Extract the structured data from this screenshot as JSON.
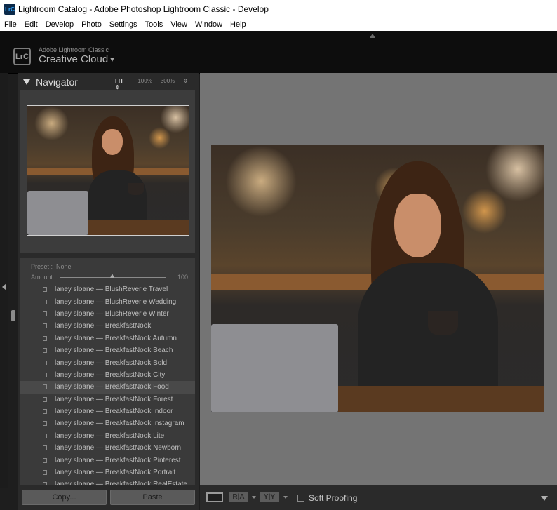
{
  "window": {
    "title": "Lightroom Catalog - Adobe Photoshop Lightroom Classic - Develop",
    "app_icon_text": "LrC"
  },
  "menu": [
    "File",
    "Edit",
    "Develop",
    "Photo",
    "Settings",
    "Tools",
    "View",
    "Window",
    "Help"
  ],
  "identity": {
    "logo": "LrC",
    "small": "Adobe Lightroom Classic",
    "big": "Creative Cloud",
    "arrow": "▼"
  },
  "navigator": {
    "title": "Navigator",
    "zoom": {
      "fit": "FIT ⇕",
      "z100": "100%",
      "z300": "300%",
      "stepper": "⇕"
    }
  },
  "preset": {
    "preset_label": "Preset :",
    "preset_value": "None",
    "amount_label": "Amount",
    "amount_value": "100",
    "amount_fraction": 0.5
  },
  "preset_list": [
    "laney sloane — BlushReverie Travel",
    "laney sloane — BlushReverie Wedding",
    "laney sloane — BlushReverie Winter",
    "laney sloane — BreakfastNook",
    "laney sloane — BreakfastNook Autumn",
    "laney sloane — BreakfastNook Beach",
    "laney sloane — BreakfastNook Bold",
    "laney sloane — BreakfastNook City",
    "laney sloane — BreakfastNook Food",
    "laney sloane — BreakfastNook Forest",
    "laney sloane — BreakfastNook Indoor",
    "laney sloane — BreakfastNook Instagram",
    "laney sloane — BreakfastNook Lite",
    "laney sloane — BreakfastNook Newborn",
    "laney sloane — BreakfastNook Pinterest",
    "laney sloane — BreakfastNook Portrait",
    "laney sloane — BreakfastNook RealEstate"
  ],
  "selected_preset_index": 8,
  "buttons": {
    "copy": "Copy...",
    "paste": "Paste"
  },
  "toolbar": {
    "ra_label": "R|A",
    "yy_label": "Y|Y",
    "soft_proofing": "Soft Proofing"
  },
  "colors": {
    "panel": "#2a2a2a",
    "canvas": "#747474",
    "selected_row": "#494949"
  }
}
